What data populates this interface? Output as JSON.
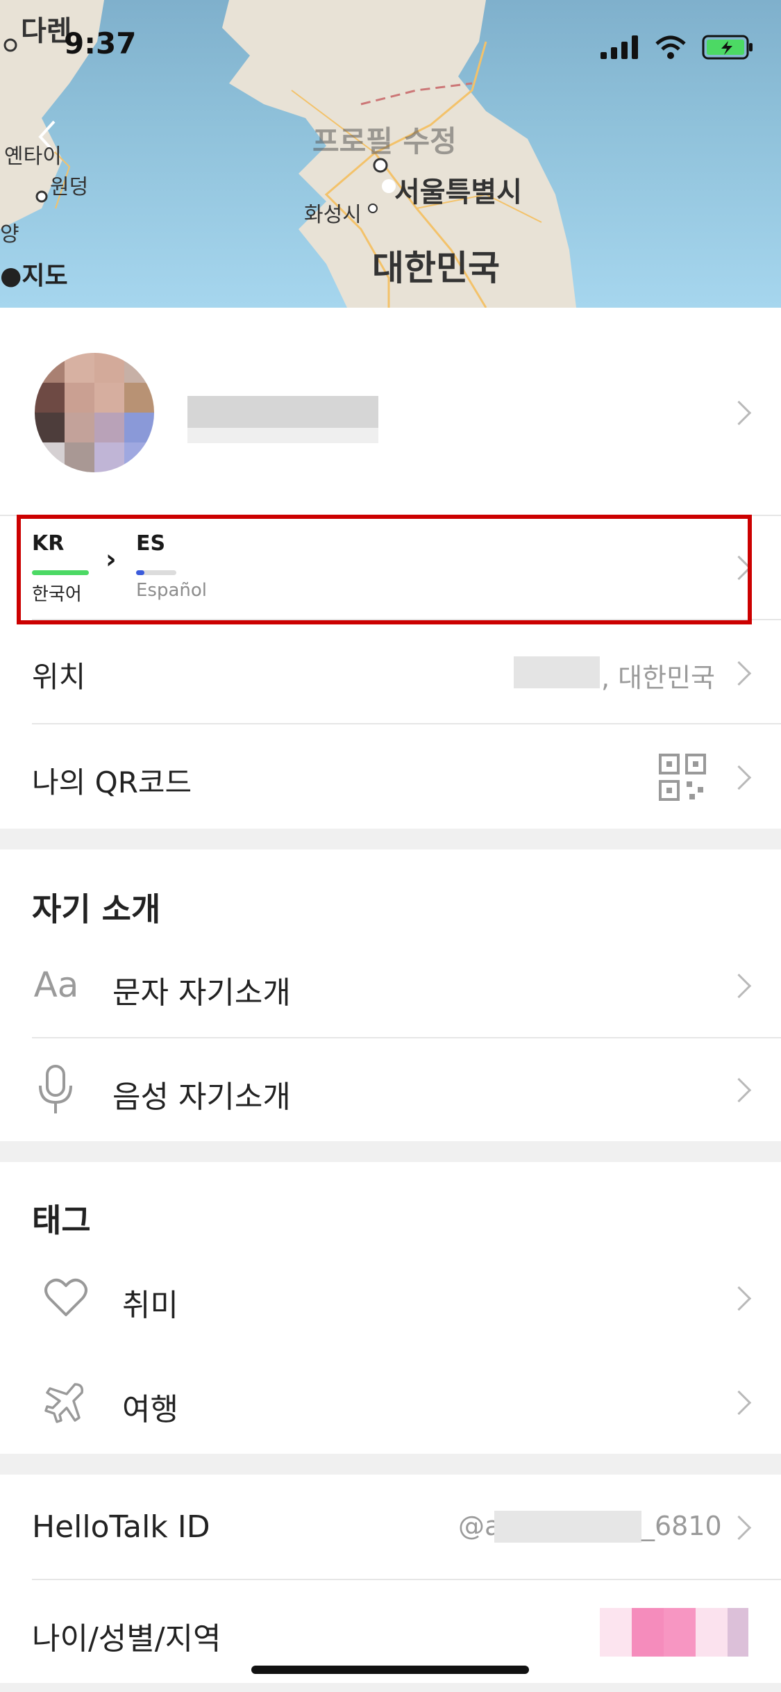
{
  "status": {
    "time": "9:37"
  },
  "map": {
    "title_overlay": "프로필 수정",
    "labels": {
      "darlen": "다렌",
      "yentai": "옌타이",
      "wondang": "원덩",
      "yang": "양",
      "seoul": "서울특별시",
      "hwaseong": "화성시",
      "korea": "대한민국",
      "apple_maps": "지도"
    }
  },
  "profile": {
    "native_lang_code": "KR",
    "native_lang_name": "한국어",
    "learning_lang_code": "ES",
    "learning_lang_name": "Español",
    "arrow": "›",
    "highlight_color": "#cc0000"
  },
  "rows": {
    "location_label": "위치",
    "location_value": ", 대한민국",
    "qr_label": "나의 QR코드"
  },
  "intro": {
    "title": "자기 소개",
    "text_icon": "Aa",
    "text_label": "문자 자기소개",
    "voice_label": "음성 자기소개"
  },
  "tags": {
    "title": "태그",
    "hobby_label": "취미",
    "travel_label": "여행"
  },
  "account": {
    "id_label": "HelloTalk ID",
    "id_value_prefix": "@a",
    "id_value_suffix": "_6810",
    "age_label": "나이/성별/지역"
  },
  "colors": {
    "native_bar": "#4cd964",
    "learning_bar": "#3b5bdb"
  }
}
